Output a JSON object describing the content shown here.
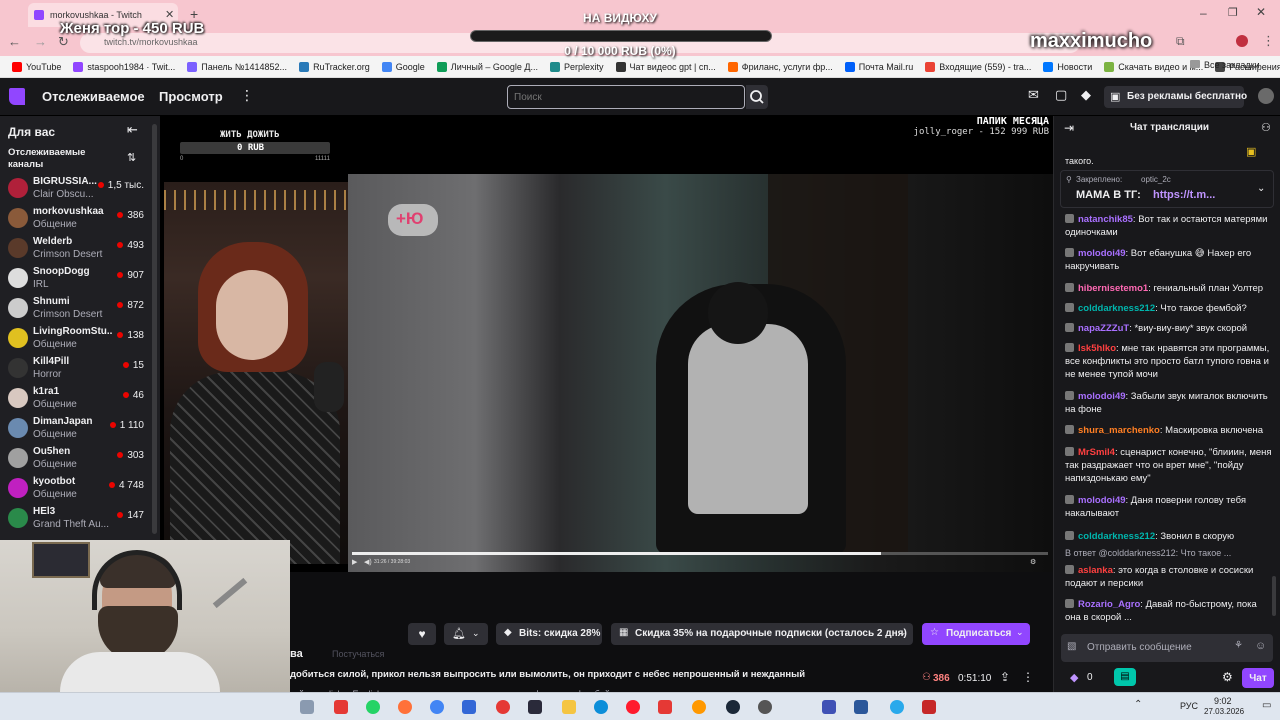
{
  "browser": {
    "tab_title": "morkovushkaa - Twitch",
    "url": "twitch.tv/morkovushkaa",
    "overlay_donation_top": "Женя тор - 450 RUB",
    "overlay_goal_title": "НА ВИДЮХУ",
    "overlay_goal_progress": "0 / 10 000 RUB (0%)",
    "overlay_goal_fraction": 0,
    "overlay_watermark": "maxximucho",
    "bookmarks": [
      {
        "label": "YouTube",
        "color": "#ff0000"
      },
      {
        "label": "staspooh1984 · Twit...",
        "color": "#9146ff"
      },
      {
        "label": "Панель №1414852...",
        "color": "#7b61ff"
      },
      {
        "label": "RuTracker.org",
        "color": "#2a7ab8"
      },
      {
        "label": "Google",
        "color": "#4285f4"
      },
      {
        "label": "Личный – Google Д...",
        "color": "#0f9d58"
      },
      {
        "label": "Perplexity",
        "color": "#1f8b8b"
      },
      {
        "label": "Чат видеос gpt | сп...",
        "color": "#333333"
      },
      {
        "label": "Фриланс, услуги фр...",
        "color": "#ff6600"
      },
      {
        "label": "Почта Mail.ru",
        "color": "#005ff9"
      },
      {
        "label": "Входящие (559) - tra...",
        "color": "#ea4335"
      },
      {
        "label": "Новости",
        "color": "#0077ff"
      },
      {
        "label": "Скачать видео и м...",
        "color": "#7cb342"
      },
      {
        "label": "Расширения",
        "color": "#444444"
      }
    ],
    "all_bookmarks": "Все закладки"
  },
  "header": {
    "following": "Отслеживаемое",
    "browse": "Просмотр",
    "search_placeholder": "Поиск",
    "ad_free": "Без рекламы бесплатно"
  },
  "sidebar": {
    "for_you": "Для вас",
    "followed_channels": "Отслеживаемые каналы",
    "channels": [
      {
        "name": "BIGRUSSIA...",
        "game": "Clair Obscu...",
        "viewers": "1,5 тыс.",
        "color": "#b0203a"
      },
      {
        "name": "morkovushkaa",
        "game": "Общение",
        "viewers": "386",
        "color": "#8a5a3a"
      },
      {
        "name": "Welderb",
        "game": "Crimson Desert",
        "viewers": "493",
        "color": "#5a3a2a"
      },
      {
        "name": "SnoopDogg",
        "game": "IRL",
        "viewers": "907",
        "color": "#dddddd"
      },
      {
        "name": "Shnumi",
        "game": "Crimson Desert",
        "viewers": "872",
        "color": "#cccccc"
      },
      {
        "name": "LivingRoomStu...",
        "game": "Общение",
        "viewers": "138",
        "color": "#e0c020"
      },
      {
        "name": "Kill4Pill",
        "game": "Horror",
        "viewers": "15",
        "color": "#333333"
      },
      {
        "name": "k1ra1",
        "game": "Общение",
        "viewers": "46",
        "color": "#d8c8c0"
      },
      {
        "name": "DimanJapan",
        "game": "Общение",
        "viewers": "1 110",
        "color": "#6a8ab0"
      },
      {
        "name": "Ou5hen",
        "game": "Общение",
        "viewers": "303",
        "color": "#a0a0a0"
      },
      {
        "name": "kyootbot",
        "game": "Общение",
        "viewers": "4 748",
        "color": "#c020c0"
      },
      {
        "name": "HEl3",
        "game": "Grand Theft Au...",
        "viewers": "147",
        "color": "#2a8a4a"
      }
    ]
  },
  "video": {
    "stream_overlay_left_title": "ЖИТЬ ДОЖИТЬ",
    "stream_overlay_left_value": "0 RUB",
    "stream_overlay_left_min": "0",
    "stream_overlay_left_max": "11111",
    "stream_overlay_right_title": "ПАПИК МЕСЯЦА",
    "stream_overlay_right_value": "jolly_roger - 152 999 RUB",
    "inner_logo": "+Ю",
    "inner_progress_fraction": 0.76,
    "inner_time": "31:26 / 39:28:03"
  },
  "actions": {
    "bits": "Bits: скидка 28%",
    "gift_sub": "Скидка 35% на подарочные подписки (осталось 2 дня)",
    "subscribe": "Подписаться",
    "follow_label": "Постучаться",
    "stream_title": "добиться силой, прикол нельзя выпросить или вымолить, он приходит с небес непрошенный и нежданный",
    "channel_fragment": "ва",
    "viewers": "386",
    "uptime": "0:51:10",
    "tags": [
      "кий",
      "english",
      "English",
      "девушка",
      "рыжая",
      "рыжая",
      "шизофрения",
      "фембой"
    ]
  },
  "chat": {
    "title": "Чат трансляции",
    "pinned_label": "Закреплено:",
    "pinned_user": "optic_2c",
    "pinned_text": "МАМА В ТГ:",
    "pinned_link": "https://t.m...",
    "top_fragment": "такого.",
    "messages": [
      {
        "user": "natanchik85",
        "color": "#a970ff",
        "text": "Вот так и остаются матерями одиночками"
      },
      {
        "user": "molodoi49",
        "color": "#a970ff",
        "text": "Вот ебанушка 😅 Нахер его накручивать"
      },
      {
        "user": "hibernisetemo1",
        "color": "#ff69b4",
        "text": "гениальный план Уолтер"
      },
      {
        "user": "colddarkness212",
        "color": "#00b5ad",
        "text": "Что такое фембой?"
      },
      {
        "user": "napaZZZuT",
        "color": "#a970ff",
        "text": "*виу-виу-виу* звук скорой"
      },
      {
        "user": "lsk5hlko",
        "color": "#ff4040",
        "text": "мне так нравятся эти программы, все конфликты это просто батл тупого говна и не менее тупой мочи"
      },
      {
        "user": "molodoi49",
        "color": "#a970ff",
        "text": "Забыли звук мигалок включить на фоне"
      },
      {
        "user": "shura_marchenko",
        "color": "#ff7f24",
        "text": "Маскировка включена"
      },
      {
        "user": "MrSmil4",
        "color": "#ff4040",
        "text": "сценарист конечно, \"блииин, меня так раздражает что он врет мне\", \"пойду напиздонькаю ему\""
      },
      {
        "user": "molodoi49",
        "color": "#a970ff",
        "text": "Даня поверни голову тебя накалывают"
      },
      {
        "user": "colddarkness212",
        "color": "#00b5ad",
        "text": "Звонил в скорую"
      },
      {
        "user": "aslanka",
        "color": "#ff4040",
        "text": "это когда в столовке и сосиски подают и персики"
      },
      {
        "user": "Rozario_Agro",
        "color": "#a970ff",
        "text": "Давай по-быстрому, пока она в скорой ..."
      }
    ],
    "reply_to": "В ответ @colddarkness212: Что такое ...",
    "input_placeholder": "Отправить сообщение",
    "points": "0",
    "send": "Чат"
  },
  "taskbar": {
    "lang": "РУС",
    "time": "9:02",
    "date": "27.03.2026"
  }
}
